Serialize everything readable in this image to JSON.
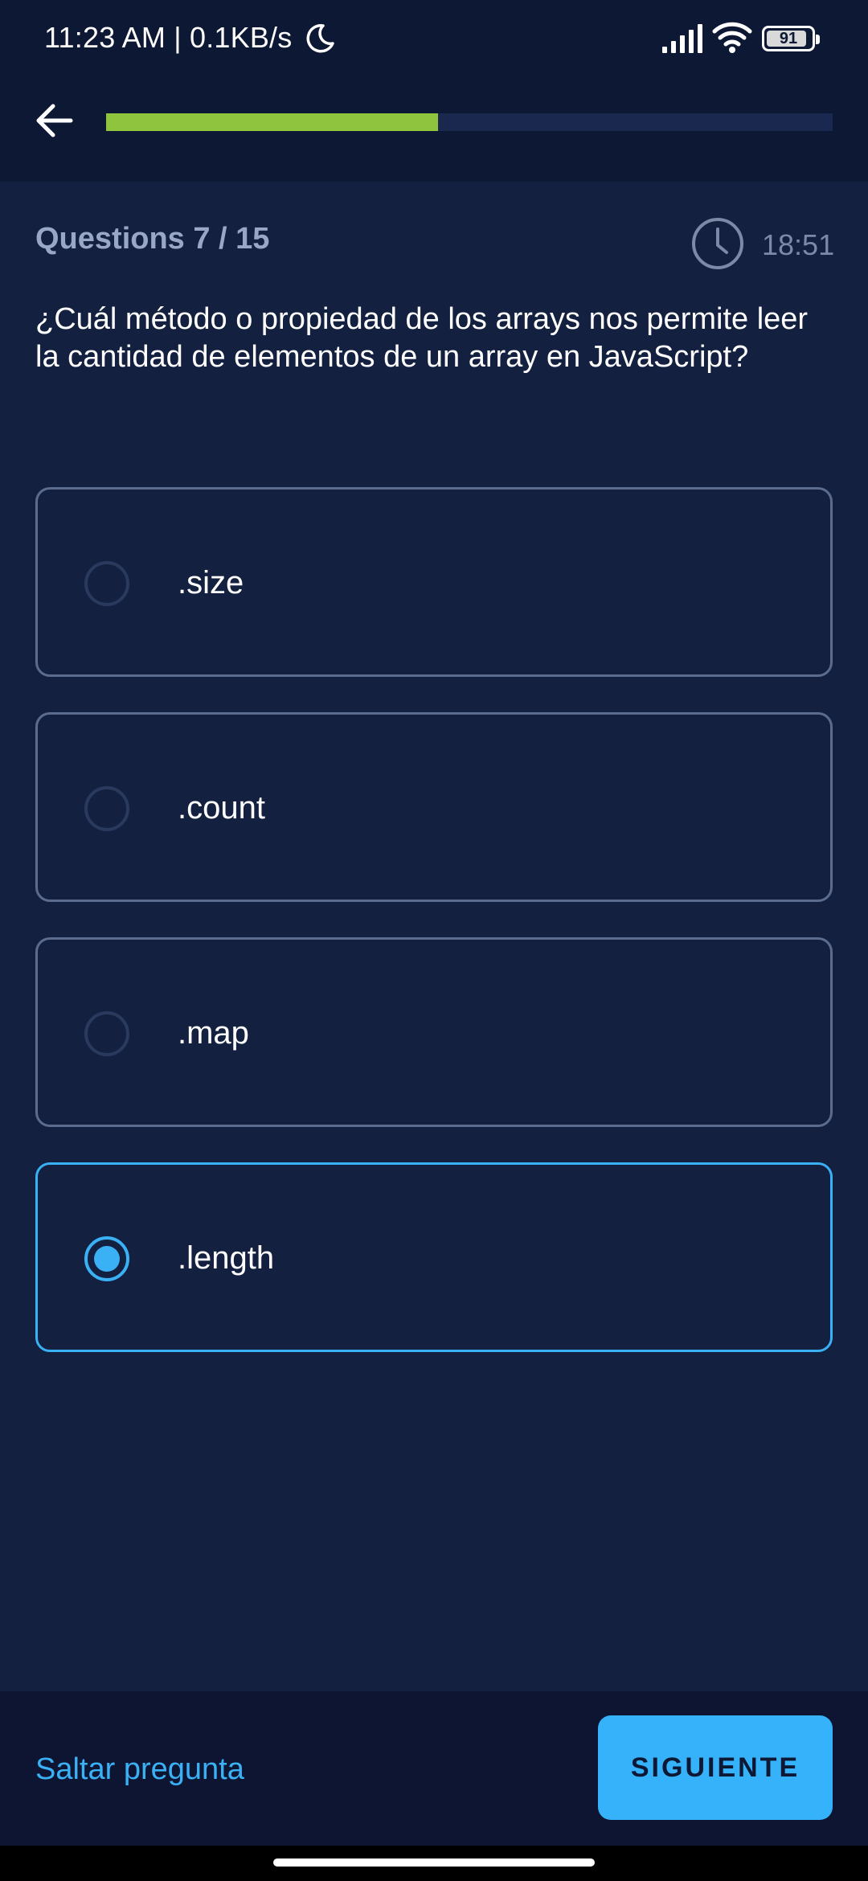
{
  "status_bar": {
    "time_text": "11:23 AM | 0.1KB/s",
    "battery_level": "91",
    "icons": [
      "moon-icon",
      "signal-icon",
      "wifi-icon",
      "battery-icon"
    ]
  },
  "header": {
    "back_icon": "arrow-left-icon",
    "progress_fraction": 0.4567,
    "progress_color": "#8fc43f"
  },
  "quiz": {
    "question_counter": "Questions 7 / 15",
    "timer": "18:51",
    "timer_icon": "clock-icon",
    "question": "¿Cuál método o propiedad de los arrays nos permite leer la cantidad de elementos de un array en JavaScript?",
    "options": [
      {
        "label": ".size",
        "selected": false
      },
      {
        "label": ".count",
        "selected": false
      },
      {
        "label": ".map",
        "selected": false
      },
      {
        "label": ".length",
        "selected": true
      }
    ]
  },
  "footer": {
    "skip_label": "Saltar pregunta",
    "next_label": "SIGUIENTE"
  },
  "colors": {
    "background": "#13203f",
    "accent": "#3ab0f5",
    "progress": "#8fc43f"
  }
}
